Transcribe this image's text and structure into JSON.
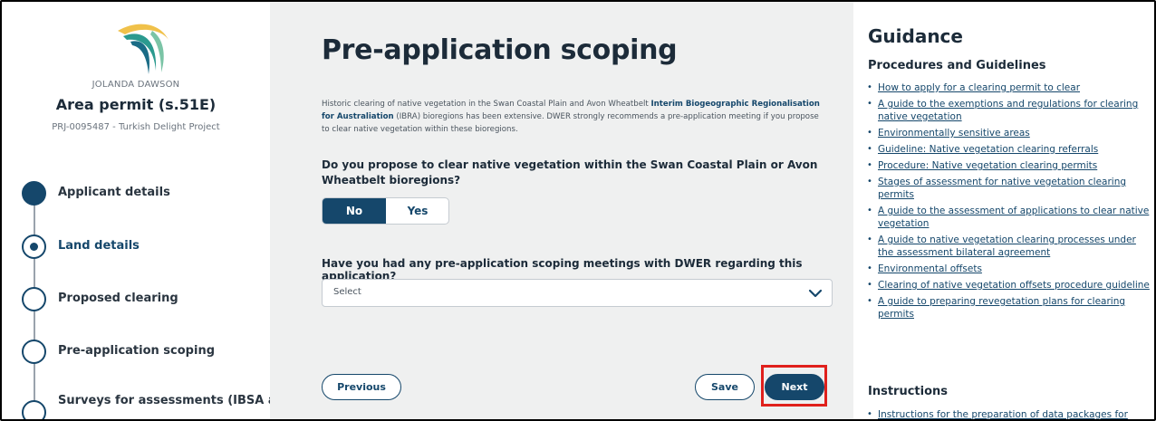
{
  "sidebar": {
    "user_name": "JOLANDA DAWSON",
    "permit_type": "Area permit (s.51E)",
    "project_id": "PRJ-0095487 - Turkish Delight Project",
    "steps": [
      {
        "label": "Applicant details",
        "state": "completed"
      },
      {
        "label": "Land details",
        "state": "current"
      },
      {
        "label": "Proposed clearing",
        "state": "pending"
      },
      {
        "label": "Pre-application scoping",
        "state": "pending"
      },
      {
        "label": "Surveys for assessments (IBSA and",
        "state": "pending"
      }
    ]
  },
  "main": {
    "title": "Pre-application scoping",
    "intro_before": "Historic clearing of native vegetation in the Swan Coastal Plain and Avon Wheatbelt ",
    "intro_link": "Interim Biogeographic Regionalisation for Australiation",
    "intro_after": " (IBRA) bioregions has been extensive. DWER strongly recommends a pre-application meeting if you propose to clear native vegetation within these bioregions.",
    "question1": "Do you propose to clear native vegetation within the Swan Coastal Plain or Avon Wheatbelt bioregions?",
    "toggle": {
      "no_label": "No",
      "yes_label": "Yes",
      "selected": "No"
    },
    "question2": "Have you had any pre-application scoping meetings with DWER regarding this application?",
    "select_value": "Select",
    "buttons": {
      "previous": "Previous",
      "save": "Save",
      "next": "Next"
    }
  },
  "guidance": {
    "title": "Guidance",
    "procedures_heading": "Procedures and Guidelines",
    "links": [
      "How to apply for a clearing permit to clear",
      "A guide to the exemptions and regulations for clearing native vegetation",
      "Environmentally sensitive areas",
      "Guideline: Native vegetation clearing referrals",
      "Procedure: Native vegetation clearing permits",
      "Stages of assessment for native vegetation clearing permits",
      "A guide to the assessment of applications to clear native vegetation",
      "A guide to native vegetation clearing processes under the assessment bilateral agreement",
      "Environmental offsets",
      "Clearing of native vegetation offsets procedure guideline",
      "A guide to preparing revegetation plans for clearing permits"
    ],
    "instructions_heading": "Instructions",
    "instruction_links": [
      "Instructions for the preparation of data packages for"
    ]
  },
  "colors": {
    "primary": "#15476b",
    "highlight": "#e0201c",
    "main_bg": "#eff0f0"
  }
}
